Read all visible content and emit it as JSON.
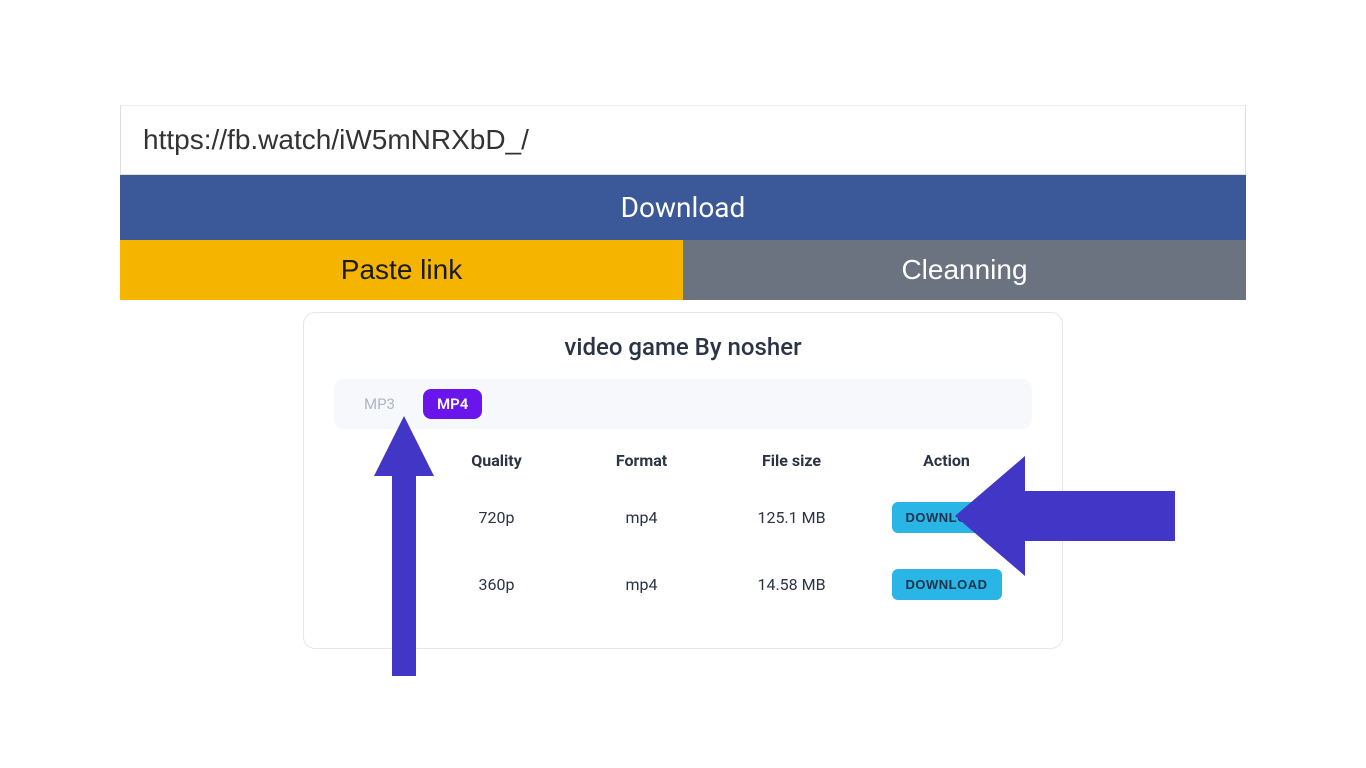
{
  "input": {
    "url_value": "https://fb.watch/iW5mNRXbD_/"
  },
  "main_actions": {
    "download_label": "Download",
    "paste_label": "Paste link",
    "clean_label": "Cleanning"
  },
  "results": {
    "title": "video game By nosher",
    "format_tabs": {
      "mp3_label": "MP3",
      "mp4_label": "MP4"
    },
    "table_headers": {
      "quality": "Quality",
      "format": "Format",
      "file_size": "File size",
      "action": "Action"
    },
    "rows": [
      {
        "quality": "720p",
        "format": "mp4",
        "file_size": "125.1 MB",
        "action_label": "DOWNLOAD"
      },
      {
        "quality": "360p",
        "format": "mp4",
        "file_size": "14.58 MB",
        "action_label": "DOWNLOAD"
      }
    ]
  },
  "annotations": {
    "arrow_color": "#4236c7"
  }
}
